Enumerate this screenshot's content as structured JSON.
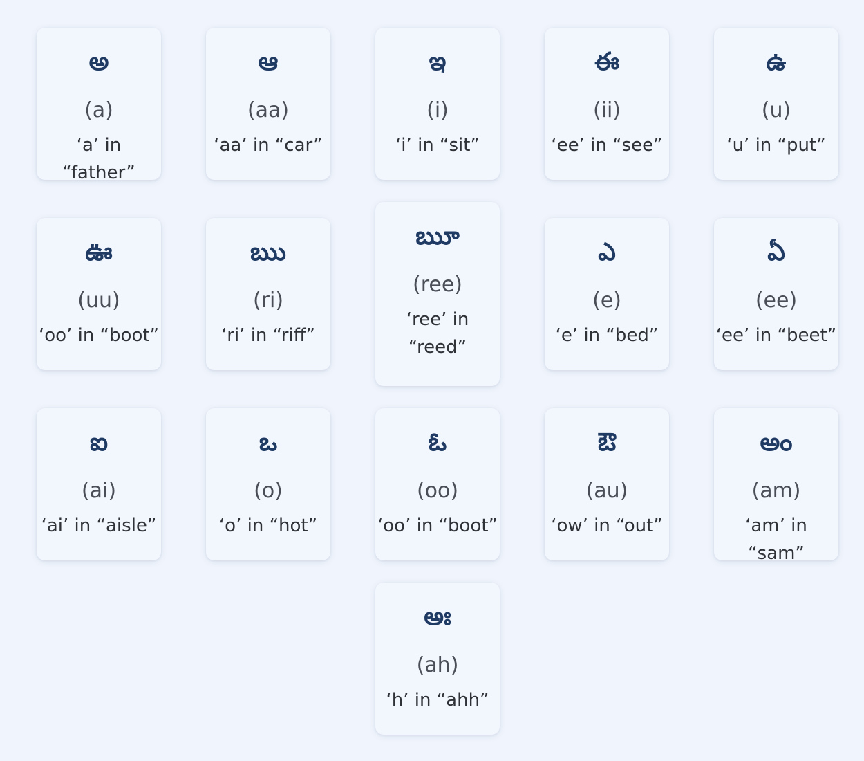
{
  "vowels": [
    {
      "glyph": "అ",
      "translit": "(a)",
      "hint": "‘a’ in “father”"
    },
    {
      "glyph": "ఆ",
      "translit": "(aa)",
      "hint": "‘aa’ in “car”"
    },
    {
      "glyph": "ఇ",
      "translit": "(i)",
      "hint": "‘i’ in “sit”"
    },
    {
      "glyph": "ఈ",
      "translit": "(ii)",
      "hint": "‘ee’ in “see”"
    },
    {
      "glyph": "ఉ",
      "translit": "(u)",
      "hint": "‘u’ in “put”"
    },
    {
      "glyph": "ఊ",
      "translit": "(uu)",
      "hint": "‘oo’ in “boot”"
    },
    {
      "glyph": "ఋ",
      "translit": "(ri)",
      "hint": "‘ri’ in “riff”"
    },
    {
      "glyph": "ౠ",
      "translit": "(ree)",
      "hint": "‘ree’ in “reed”"
    },
    {
      "glyph": "ఎ",
      "translit": "(e)",
      "hint": "‘e’ in “bed”"
    },
    {
      "glyph": "ఏ",
      "translit": "(ee)",
      "hint": "‘ee’ in “beet”"
    },
    {
      "glyph": "ఐ",
      "translit": "(ai)",
      "hint": "‘ai’ in “aisle”"
    },
    {
      "glyph": "ఒ",
      "translit": "(o)",
      "hint": "‘o’ in “hot”"
    },
    {
      "glyph": "ఓ",
      "translit": "(oo)",
      "hint": "‘oo’ in “boot”"
    },
    {
      "glyph": "ఔ",
      "translit": "(au)",
      "hint": "‘ow’ in “out”"
    },
    {
      "glyph": "అం",
      "translit": "(am)",
      "hint": "‘am’ in “sam”"
    },
    {
      "glyph": "అః",
      "translit": "(ah)",
      "hint": "‘h’ in “ahh”"
    }
  ],
  "colors": {
    "background": "#f0f5fd",
    "card": "#f2f6fd",
    "glyph": "#1f3a63",
    "translit": "#4a4f57",
    "hint": "#2f3338"
  }
}
